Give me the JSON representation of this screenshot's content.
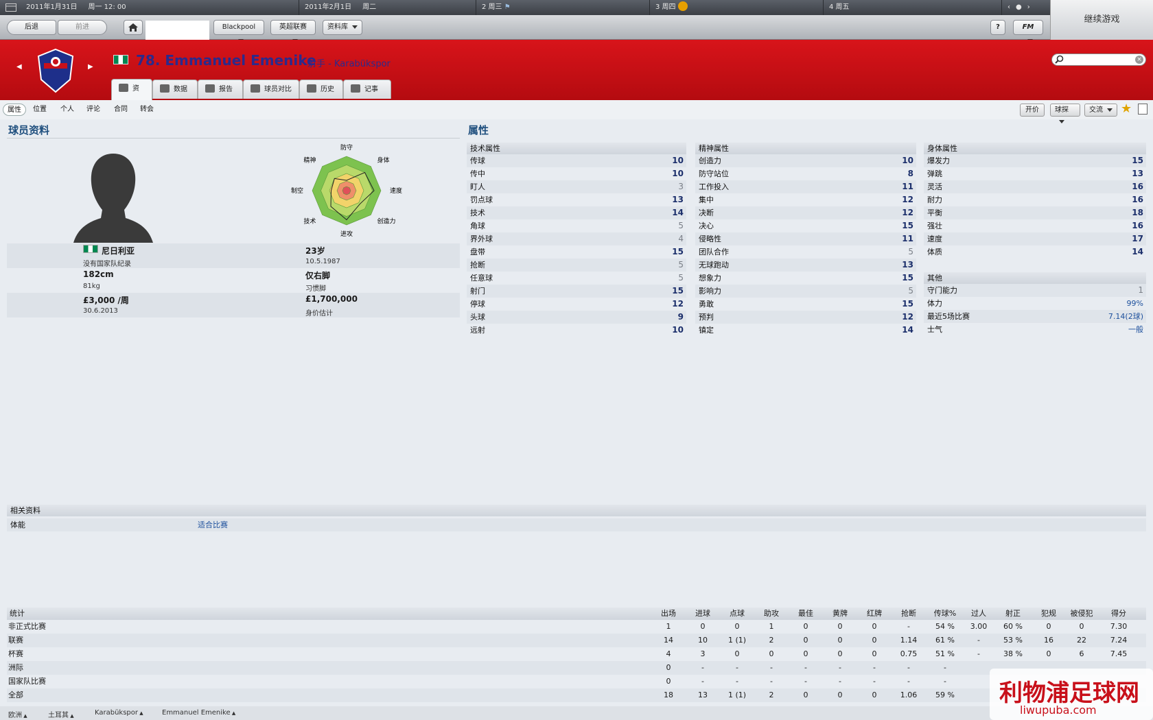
{
  "calendar": {
    "day1_date": "2011年1月31日",
    "day1_week": "周一 12: 00",
    "day2_date": "2011年2月1日",
    "day2_week": "周二",
    "day3": "2 周三",
    "day4": "3 周四",
    "day5": "4 周五"
  },
  "continue_label": "继续游戏",
  "toolbar": {
    "back": "后退",
    "forward": "前进",
    "club": "Blackpool",
    "league": "英超联赛",
    "database": "资料库",
    "fm": "FM"
  },
  "player": {
    "number_name": "78. Emmanuel Emenike",
    "position_club": "射手 - Karabükspor"
  },
  "tabs": [
    "资料",
    "数据",
    "报告",
    "球员对比",
    "历史",
    "记事本"
  ],
  "subnav": [
    "属性",
    "位置",
    "个人",
    "评论",
    "合同",
    "转会"
  ],
  "actions": {
    "offer": "开价",
    "scout": "球探",
    "interact": "交流"
  },
  "profile": {
    "title": "球员资料",
    "nation": "尼日利亚",
    "nat_record": "没有国家队纪录",
    "age": "23岁",
    "dob": "10.5.1987",
    "height": "182cm",
    "weight": "81kg",
    "foot": "仅右脚",
    "foot_label": "习惯脚",
    "wage": "£3,000 /周",
    "contract": "30.6.2013",
    "value": "£1,700,000",
    "value_label": "身价估计"
  },
  "radar_labels": [
    "防守",
    "身体",
    "速度",
    "创造力",
    "进攻",
    "技术",
    "制空",
    "精神"
  ],
  "attributes_title": "属性",
  "technical": {
    "title": "技术属性",
    "items": [
      [
        "传球",
        "10"
      ],
      [
        "传中",
        "10"
      ],
      [
        "盯人",
        "3"
      ],
      [
        "罚点球",
        "13"
      ],
      [
        "技术",
        "14"
      ],
      [
        "角球",
        "5"
      ],
      [
        "界外球",
        "4"
      ],
      [
        "盘带",
        "15"
      ],
      [
        "抢断",
        "5"
      ],
      [
        "任意球",
        "5"
      ],
      [
        "射门",
        "15"
      ],
      [
        "停球",
        "12"
      ],
      [
        "头球",
        "9"
      ],
      [
        "远射",
        "10"
      ]
    ]
  },
  "mental": {
    "title": "精神属性",
    "items": [
      [
        "创造力",
        "10"
      ],
      [
        "防守站位",
        "8"
      ],
      [
        "工作投入",
        "11"
      ],
      [
        "集中",
        "12"
      ],
      [
        "决断",
        "12"
      ],
      [
        "决心",
        "15"
      ],
      [
        "侵略性",
        "11"
      ],
      [
        "团队合作",
        "5"
      ],
      [
        "无球跑动",
        "13"
      ],
      [
        "想象力",
        "15"
      ],
      [
        "影响力",
        "5"
      ],
      [
        "勇敢",
        "15"
      ],
      [
        "预判",
        "12"
      ],
      [
        "镇定",
        "14"
      ]
    ]
  },
  "physical": {
    "title": "身体属性",
    "items": [
      [
        "爆发力",
        "15"
      ],
      [
        "弹跳",
        "13"
      ],
      [
        "灵活",
        "16"
      ],
      [
        "耐力",
        "16"
      ],
      [
        "平衡",
        "18"
      ],
      [
        "强壮",
        "16"
      ],
      [
        "速度",
        "17"
      ],
      [
        "体质",
        "14"
      ]
    ]
  },
  "other": {
    "title": "其他",
    "items": [
      [
        "守门能力",
        "1"
      ],
      [
        "体力",
        "99%"
      ],
      [
        "最近5场比赛",
        "7.14(2球)"
      ],
      [
        "士气",
        "一般"
      ]
    ]
  },
  "related": {
    "title": "相关资料",
    "label": "体能",
    "value": "适合比赛"
  },
  "stats": {
    "headers": [
      "统计",
      "出场",
      "进球",
      "点球",
      "助攻",
      "最佳",
      "黄牌",
      "红牌",
      "抢断",
      "传球%",
      "过人",
      "射正",
      "犯规",
      "被侵犯",
      "得分"
    ],
    "rows": [
      [
        "非正式比赛",
        "1",
        "0",
        "0",
        "1",
        "0",
        "0",
        "0",
        "-",
        "54 %",
        "3.00",
        "60 %",
        "0",
        "0",
        "7.30"
      ],
      [
        "联赛",
        "14",
        "10",
        "1 (1)",
        "2",
        "0",
        "0",
        "0",
        "1.14",
        "61 %",
        "-",
        "53 %",
        "16",
        "22",
        "7.24"
      ],
      [
        "杯赛",
        "4",
        "3",
        "0",
        "0",
        "0",
        "0",
        "0",
        "0.75",
        "51 %",
        "-",
        "38 %",
        "0",
        "6",
        "7.45"
      ],
      [
        "洲际",
        "0",
        "-",
        "-",
        "-",
        "-",
        "-",
        "-",
        "-",
        "-",
        "",
        "",
        "",
        "",
        ""
      ],
      [
        "国家队比赛",
        "0",
        "-",
        "-",
        "-",
        "-",
        "-",
        "-",
        "-",
        "-",
        "",
        "",
        "",
        "",
        ""
      ],
      [
        "全部",
        "18",
        "13",
        "1 (1)",
        "2",
        "0",
        "0",
        "0",
        "1.06",
        "59 %",
        "",
        "",
        "",
        "",
        ""
      ]
    ]
  },
  "footer": [
    "欧洲",
    "土耳其",
    "Karabükspor",
    "Emmanuel Emenike"
  ],
  "watermark": {
    "cn": "利物浦足球网",
    "url": "liwupuba.com"
  },
  "colors": {
    "header_red": "#c8101a",
    "accent_blue": "#1f4f7e",
    "value_blue": "#1c2f6b"
  }
}
